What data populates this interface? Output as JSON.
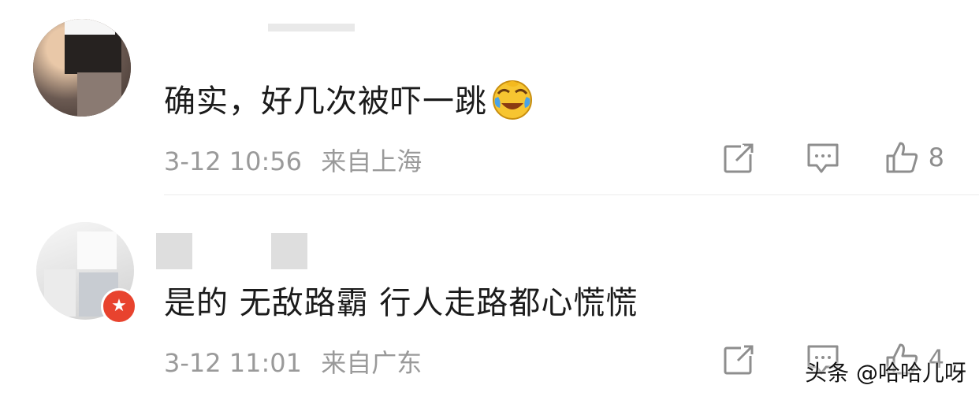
{
  "comments": [
    {
      "text": "确实，好几次被吓一跳",
      "emoji": "laughing-crying-emoji",
      "time": "3-12 10:56",
      "location": "来自上海",
      "likes": "8"
    },
    {
      "text": "是的  无敌路霸  行人走路都心慌慌",
      "time": "3-12 11:01",
      "location": "来自广东",
      "likes": "4",
      "badge_icon": "star-icon"
    }
  ],
  "watermark": "头条 @哈哈儿呀",
  "colors": {
    "meta_gray": "#9a9a9a",
    "badge_red": "#e8432e",
    "emoji_yellow": "#f7c531",
    "emoji_tear": "#4aa3e6"
  }
}
